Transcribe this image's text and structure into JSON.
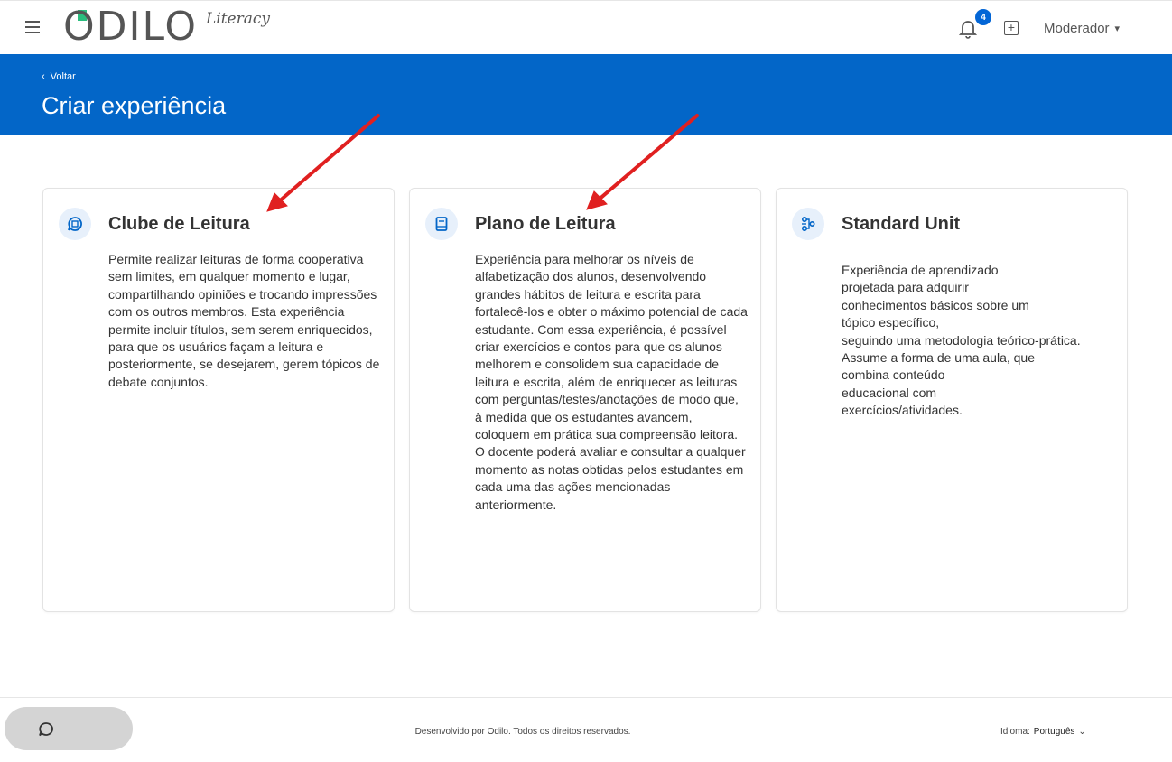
{
  "app": {
    "logo_text": "ODILO",
    "logo_sub": "Literacy",
    "notifications_count": "4",
    "user_label": "Moderador"
  },
  "header": {
    "back_label": "Voltar",
    "title": "Criar experiência"
  },
  "cards": [
    {
      "title": "Clube de Leitura",
      "icon": "chat-book-icon",
      "description": "Permite realizar leituras de forma cooperativa sem limites, em qualquer momento e lugar, compartilhando opiniões e trocando impressões com os outros membros. Esta experiência permite incluir títulos, sem serem enriquecidos, para que os usuários façam a leitura e posteriormente, se desejarem, gerem tópicos de debate conjuntos."
    },
    {
      "title": "Plano de Leitura",
      "icon": "book-icon",
      "description": "Experiência para melhorar os níveis de alfabetização dos alunos, desenvolvendo grandes hábitos de leitura e escrita para fortalecê-los e obter o máximo potencial de cada estudante. Com essa experiência, é possível criar exercícios e contos para que os alunos melhorem e consolidem sua capacidade de leitura e escrita, além de enriquecer as leituras com perguntas/testes/anotações de modo que, à medida que os estudantes avancem, coloquem em prática sua compreensão leitora. O docente poderá avaliar e consultar a qualquer momento as notas obtidas pelos estudantes em cada uma das ações mencionadas anteriormente."
    },
    {
      "title": "Standard Unit",
      "icon": "network-icon",
      "description": "Experiência de aprendizado\nprojetada para adquirir\n conhecimentos básicos sobre um\ntópico específico,\nseguindo uma metodologia teórico-prática.\nAssume a forma de uma aula, que\ncombina conteúdo\n educacional com\nexercícios/atividades."
    }
  ],
  "footer": {
    "copyright": "Desenvolvido por Odilo. Todos os direitos reservados.",
    "language_label": "Idioma:",
    "language_value": "Português"
  },
  "colors": {
    "primary": "#0366c8",
    "arrow": "#e02020",
    "badge": "#0366d6"
  }
}
